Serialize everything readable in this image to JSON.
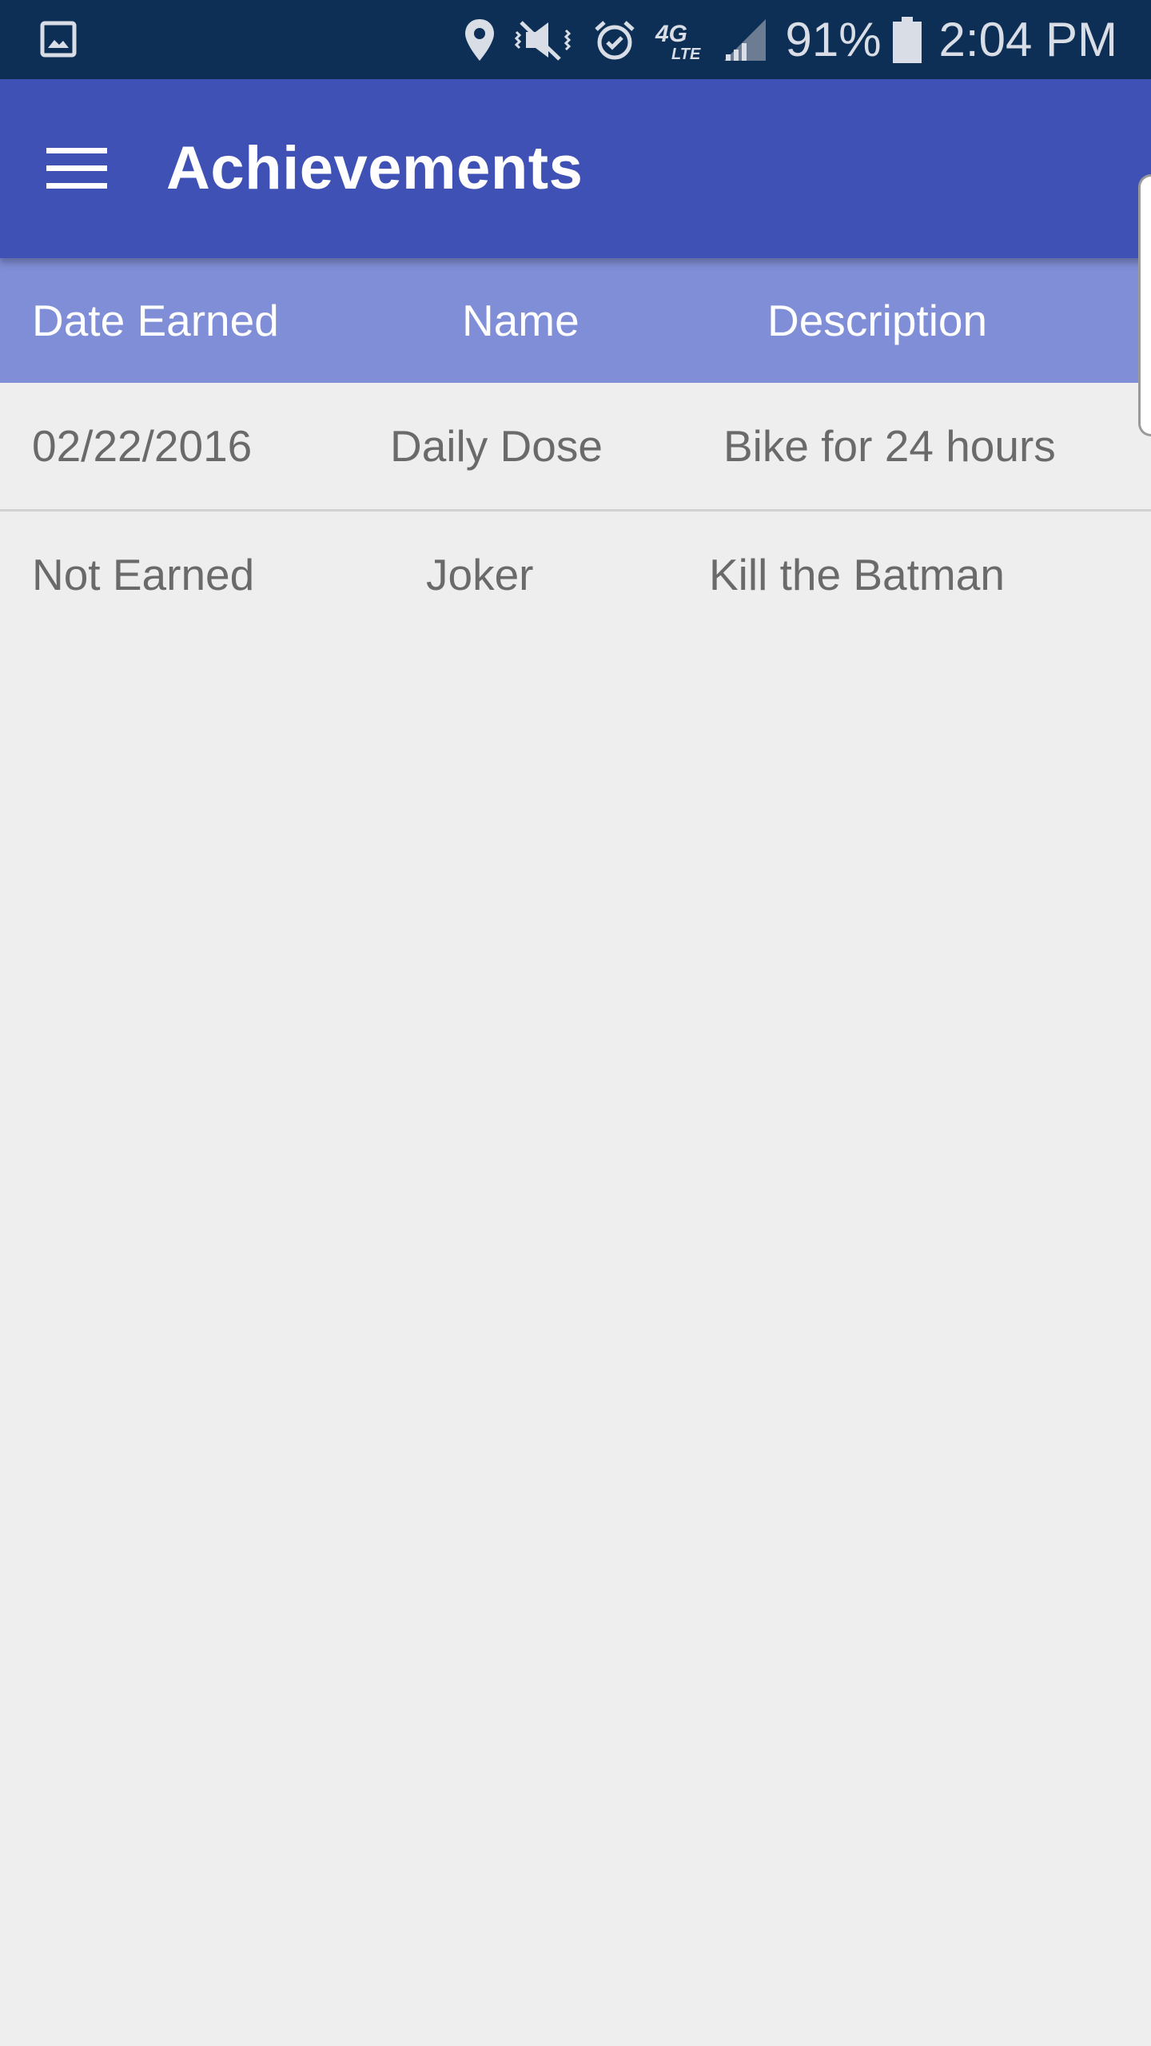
{
  "status_bar": {
    "battery_percent": "91%",
    "time": "2:04 PM",
    "network_label": "4G LTE",
    "icons": [
      "gallery-icon",
      "location-icon",
      "mute-vibrate-icon",
      "alarm-icon",
      "lte-icon",
      "signal-icon",
      "battery-icon"
    ]
  },
  "app_bar": {
    "title": "Achievements",
    "menu_icon": "hamburger-menu-icon"
  },
  "table": {
    "columns": [
      "Date Earned",
      "Name",
      "Description"
    ],
    "rows": [
      {
        "date": "02/22/2016",
        "name": "Daily Dose",
        "description": "Bike for 24 hours"
      },
      {
        "date": "Not Earned",
        "name": "Joker",
        "description": "Kill the Batman"
      }
    ]
  },
  "colors": {
    "status_bar": "#0e2f55",
    "app_bar": "#3f51b5",
    "table_header": "#7f8ed6",
    "background": "#eeeeef",
    "row_text": "#6a6a6a"
  }
}
